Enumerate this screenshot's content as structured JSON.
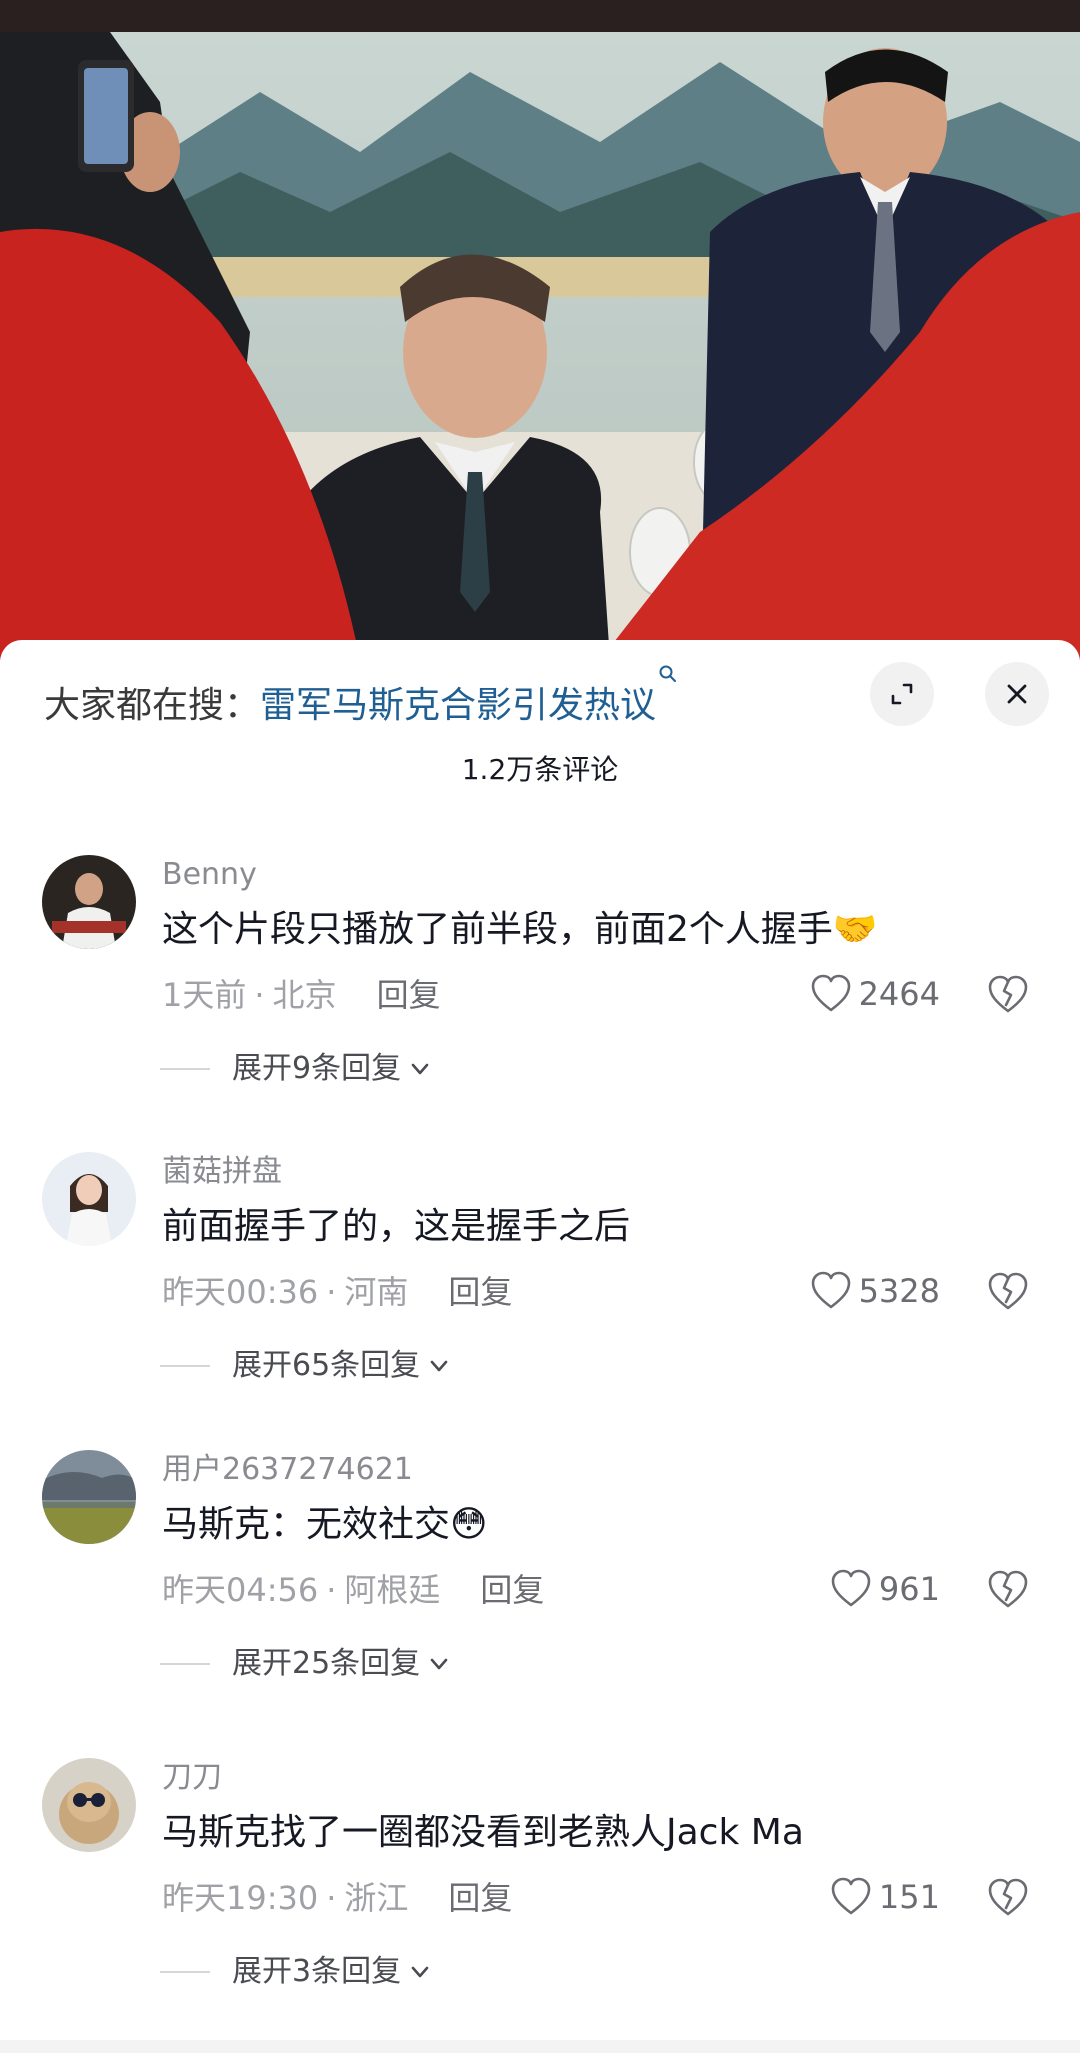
{
  "search": {
    "prefix": "大家都在搜：",
    "term": "雷军马斯克合影引发热议"
  },
  "comment_count": "1.2万条评论",
  "comments": [
    {
      "user": "Benny",
      "text": "这个片段只播放了前半段，前面2个人握手🤝",
      "time": "1天前",
      "location": "北京",
      "reply_label": "回复",
      "likes": "2464",
      "expand": "展开9条回复"
    },
    {
      "user": "菌菇拼盘",
      "text": "前面握手了的，这是握手之后",
      "time": "昨天00:36",
      "location": "河南",
      "reply_label": "回复",
      "likes": "5328",
      "expand": "展开65条回复"
    },
    {
      "user": "用户2637274621",
      "text": "马斯克：无效社交😳",
      "time": "昨天04:56",
      "location": "阿根廷",
      "reply_label": "回复",
      "likes": "961",
      "expand": "展开25条回复"
    },
    {
      "user": "刀刀",
      "text": "马斯克找了一圈都没看到老熟人Jack Ma",
      "time": "昨天19:30",
      "location": "浙江",
      "reply_label": "回复",
      "likes": "151",
      "expand": "展开3条回复"
    }
  ],
  "icons": {
    "expand": "expand-icon",
    "close": "close-icon",
    "like": "heart-icon",
    "dislike": "broken-heart-icon",
    "chevron": "chevron-down-icon",
    "search": "search-icon"
  },
  "colors": {
    "search_term": "#1f5f93",
    "meta": "#a0a1a6",
    "text": "#161823"
  }
}
